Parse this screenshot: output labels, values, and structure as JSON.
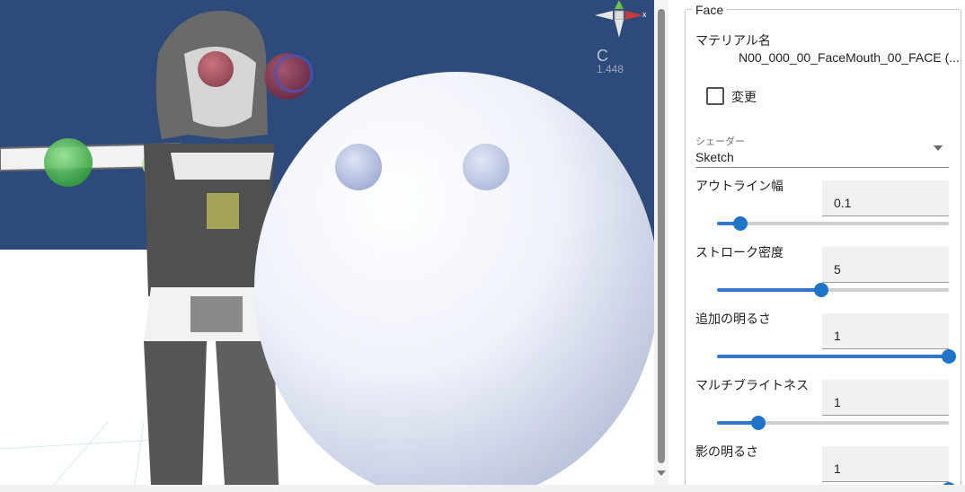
{
  "viewport": {
    "gizmo": {
      "label": "C",
      "value": "1.448",
      "x_axis_label": "x"
    }
  },
  "panel": {
    "section_title": "Face",
    "material_name_label": "マテリアル名",
    "material_name_value": "N00_000_00_FaceMouth_00_FACE (...",
    "change_checkbox": {
      "label": "変更",
      "checked": false
    },
    "shader": {
      "caption": "シェーダー",
      "value": "Sketch"
    },
    "params": [
      {
        "label": "アウトライン幅",
        "value": "0.1",
        "fraction": 0.1
      },
      {
        "label": "ストローク密度",
        "value": "5",
        "fraction": 0.45
      },
      {
        "label": "追加の明るさ",
        "value": "1",
        "fraction": 1.0
      },
      {
        "label": "マルチブライトネス",
        "value": "1",
        "fraction": 0.18
      },
      {
        "label": "影の明るさ",
        "value": "1",
        "fraction": 1.0
      }
    ]
  },
  "colors": {
    "viewport_sky": "#2d4a7a",
    "slider_accent": "#1f74c8"
  },
  "icons": [
    "axis-gizmo-icon",
    "checkbox-icon",
    "dropdown-arrow-icon",
    "scroll-down-arrow-icon"
  ]
}
